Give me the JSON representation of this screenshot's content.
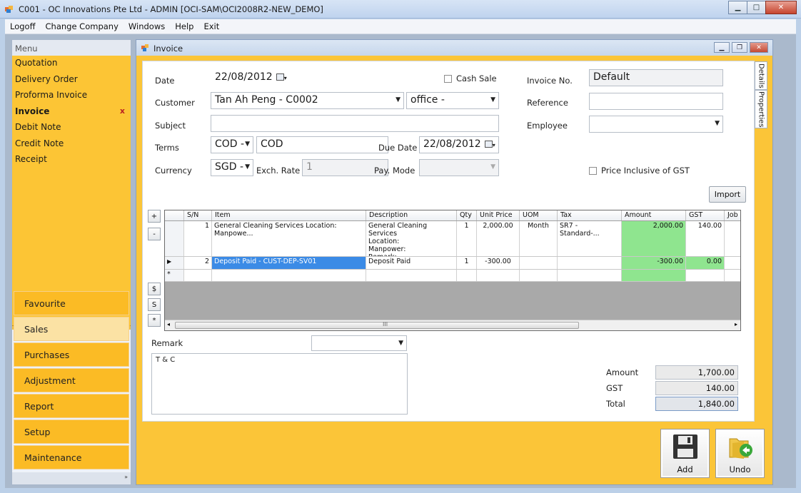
{
  "window": {
    "title": "C001 - OC Innovations Pte Ltd - ADMIN [OCI-SAM\\OCI2008R2-NEW_DEMO]",
    "minimize_icon": "minimize-icon",
    "maximize_icon": "maximize-icon",
    "close_icon": "close-icon"
  },
  "menubar": [
    "Logoff",
    "Change Company",
    "Windows",
    "Help",
    "Exit"
  ],
  "sidebar": {
    "header": "Menu",
    "items": [
      {
        "label": "Quotation"
      },
      {
        "label": "Delivery Order"
      },
      {
        "label": "Proforma Invoice"
      },
      {
        "label": "Invoice",
        "close": "x"
      },
      {
        "label": "Debit Note"
      },
      {
        "label": "Credit Note"
      },
      {
        "label": "Receipt"
      }
    ],
    "categories": [
      "Favourite",
      "Sales",
      "Purchases",
      "Adjustment",
      "Report",
      "Setup",
      "Maintenance"
    ],
    "selected_category": "Sales",
    "footer_icon": "double-chevron-right-icon"
  },
  "invoice": {
    "title": "Invoice",
    "side_tabs": [
      "Details",
      "Properties"
    ],
    "form": {
      "date_label": "Date",
      "date_value": "22/08/2012",
      "cash_sale_label": "Cash Sale",
      "invoice_no_label": "Invoice No.",
      "invoice_no_value": "Default",
      "customer_label": "Customer",
      "customer_value": "Tan Ah Peng - C0002",
      "office_value": "office -",
      "reference_label": "Reference",
      "reference_value": "",
      "subject_label": "Subject",
      "subject_value": "",
      "employee_label": "Employee",
      "employee_value": "",
      "terms_label": "Terms",
      "terms_code": "COD -",
      "terms_value": "COD",
      "due_date_label": "Due Date",
      "due_date_value": "22/08/2012",
      "currency_label": "Currency",
      "currency_value": "SGD -",
      "exch_rate_label": "Exch. Rate",
      "exch_rate_value": "1",
      "pay_mode_label": "Pay. Mode",
      "pay_mode_value": "",
      "price_incl_gst_label": "Price Inclusive of GST",
      "import_label": "Import"
    },
    "grid": {
      "columns": [
        "",
        "S/N",
        "Item",
        "Description",
        "Qty",
        "Unit Price",
        "UOM",
        "Tax",
        "Amount",
        "GST",
        "Job"
      ],
      "rows": [
        {
          "indicator": "",
          "sn": "1",
          "item": "General Cleaning Services Location: Manpowe...",
          "description": "General Cleaning Services\nLocation:\nManpower:\nRemark:",
          "qty": "1",
          "unit_price": "2,000.00",
          "uom": "Month",
          "tax": "SR7 - Standard-...",
          "amount": "2,000.00",
          "gst": "140.00",
          "job": ""
        },
        {
          "indicator": "▶",
          "sn": "2",
          "item": "Deposit Paid - CUST-DEP-SV01",
          "description": "Deposit Paid",
          "qty": "1",
          "unit_price": "-300.00",
          "uom": "",
          "tax": "",
          "amount": "-300.00",
          "gst": "0.00",
          "job": ""
        },
        {
          "indicator": "*",
          "sn": "",
          "item": "",
          "description": "",
          "qty": "",
          "unit_price": "",
          "uom": "",
          "tax": "",
          "amount": "",
          "gst": "",
          "job": ""
        }
      ],
      "side_buttons": [
        "+",
        "-",
        "$",
        "S",
        "*"
      ],
      "scroll_mark": "III"
    },
    "remark_label": "Remark",
    "remark_text": "T & C",
    "totals": {
      "amount_label": "Amount",
      "amount_value": "1,700.00",
      "gst_label": "GST",
      "gst_value": "140.00",
      "total_label": "Total",
      "total_value": "1,840.00"
    },
    "actions": {
      "add_label": "Add",
      "undo_label": "Undo"
    }
  }
}
